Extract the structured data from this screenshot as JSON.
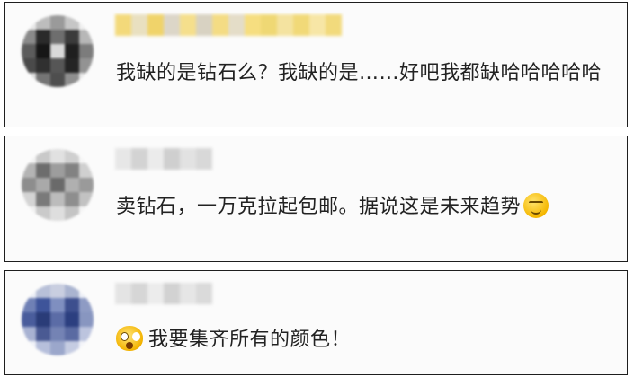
{
  "comments": [
    {
      "text": "我缺的是钻石么？我缺的是……好吧我都缺哈哈哈哈哈",
      "emoji": ""
    },
    {
      "text": "卖钻石，一万克拉起包邮。据说这是未来趋势",
      "emoji": "smirk-emoji"
    },
    {
      "text": "我要集齐所有的颜色！",
      "emoji": "shocked-emoji"
    }
  ],
  "colors": {
    "card_border": "#1e1e1e",
    "card_bg": "#fbfbfb",
    "text": "#222222"
  }
}
